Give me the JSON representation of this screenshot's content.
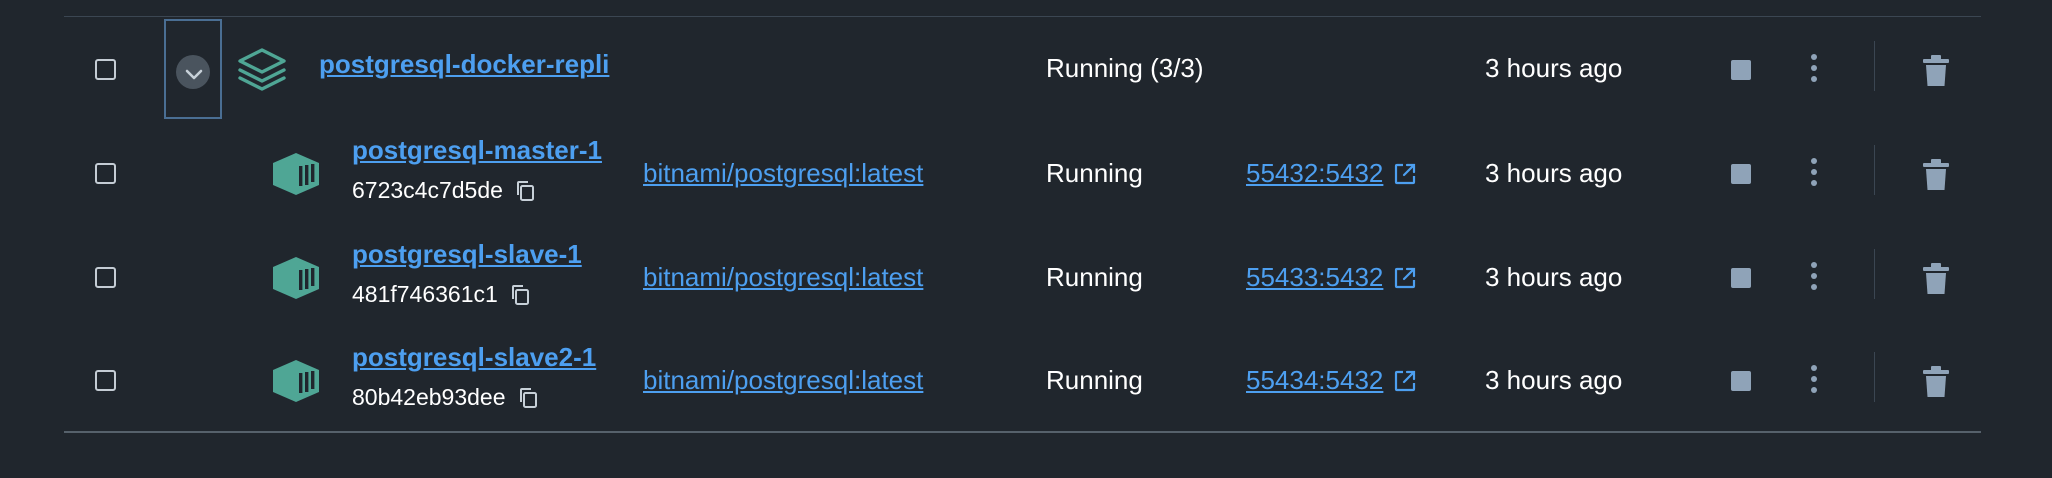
{
  "group": {
    "name": "postgresql-docker-repli",
    "status": "Running (3/3)",
    "last_started": "3 hours ago"
  },
  "containers": [
    {
      "name": "postgresql-master-1",
      "id": "6723c4c7d5de",
      "image": "bitnami/postgresql:latest",
      "status": "Running",
      "port": "55432:5432",
      "last_started": "3 hours ago"
    },
    {
      "name": "postgresql-slave-1",
      "id": "481f746361c1",
      "image": "bitnami/postgresql:latest",
      "status": "Running",
      "port": "55433:5432",
      "last_started": "3 hours ago"
    },
    {
      "name": "postgresql-slave2-1",
      "id": "80b42eb93dee",
      "image": "bitnami/postgresql:latest",
      "status": "Running",
      "port": "55434:5432",
      "last_started": "3 hours ago"
    }
  ],
  "icons": {
    "expand": "chevron-down-icon",
    "group": "stack-layers-icon",
    "container": "container-icon",
    "copy": "copy-icon",
    "external": "external-link-icon",
    "stop": "stop-icon",
    "more": "more-vertical-icon",
    "delete": "trash-icon"
  },
  "colors": {
    "background": "#20262d",
    "link": "#4d9ff0",
    "accent_teal": "#4fa695",
    "action_icon": "#8fa3b8"
  }
}
